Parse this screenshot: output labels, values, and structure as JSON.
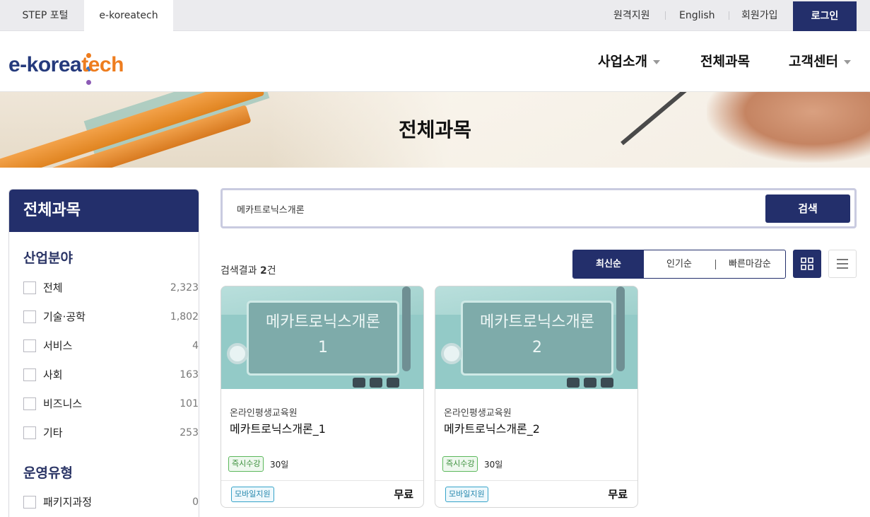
{
  "topbar": {
    "site_tabs": [
      "STEP 포털",
      "e-koreatech"
    ],
    "links": [
      "원격지원",
      "English",
      "회원가입"
    ],
    "login": "로그인"
  },
  "header": {
    "logo_part1": "e-korea",
    "logo_part2": "tech",
    "nav": [
      "사업소개",
      "전체과목",
      "고객센터"
    ]
  },
  "banner": {
    "title": "전체과목"
  },
  "sidebar": {
    "heading": "전체과목",
    "industry_title": "산업분야",
    "industry": [
      {
        "label": "전체",
        "count": "2,323"
      },
      {
        "label": "기술·공학",
        "count": "1,802"
      },
      {
        "label": "서비스",
        "count": "4"
      },
      {
        "label": "사회",
        "count": "163"
      },
      {
        "label": "비즈니스",
        "count": "101"
      },
      {
        "label": "기타",
        "count": "253"
      }
    ],
    "operation_title": "운영유형",
    "operation": [
      {
        "label": "패키지과정",
        "count": "0"
      }
    ]
  },
  "search": {
    "value": "메카트로닉스개론",
    "button": "검색"
  },
  "results": {
    "prefix": "검색결과 ",
    "count": "2",
    "suffix": "건",
    "sort": [
      "최신순",
      "인기순",
      "빠른마감순"
    ]
  },
  "courses": [
    {
      "thumb_line1": "메카트로닉스개론",
      "thumb_line2": "1",
      "org": "온라인평생교육원",
      "title": "메카트로닉스개론_1",
      "badge": "즉시수강",
      "duration": "30일",
      "mobile": "모바일지원",
      "price": "무료"
    },
    {
      "thumb_line1": "메카트로닉스개론",
      "thumb_line2": "2",
      "org": "온라인평생교육원",
      "title": "메카트로닉스개론_2",
      "badge": "즉시수강",
      "duration": "30일",
      "mobile": "모바일지원",
      "price": "무료"
    }
  ],
  "colors": {
    "primary": "#232f6b",
    "logo_blue": "#253a7c",
    "logo_orange": "#ee7d1f",
    "badge_green": "#5cb85c",
    "badge_blue": "#35a3c9"
  }
}
